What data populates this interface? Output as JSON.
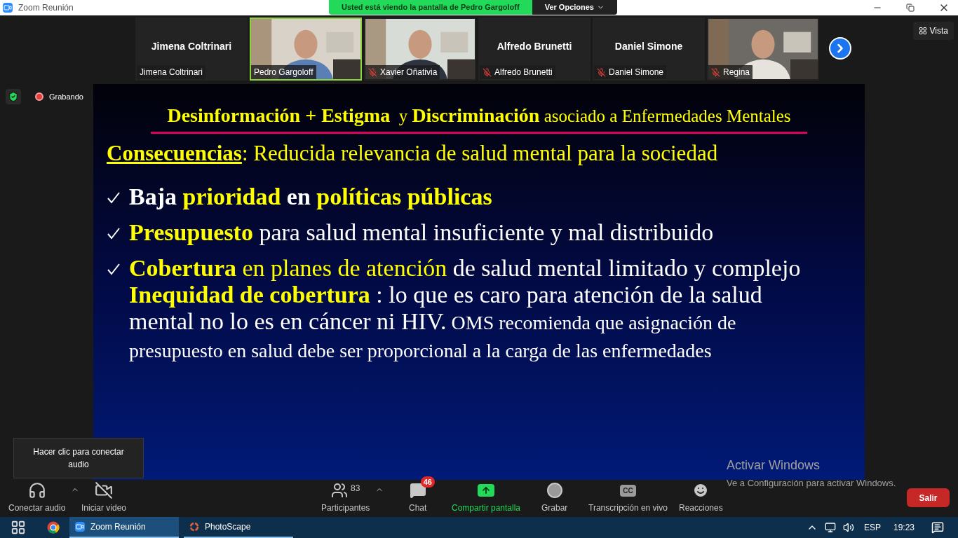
{
  "window": {
    "title": "Zoom Reunión"
  },
  "share_banner": {
    "text": "Usted está viendo la pantalla de Pedro Gargoloff",
    "options": "Ver Opciones"
  },
  "view_button": "Vista",
  "video_strip": [
    {
      "kind": "name",
      "name": "Jimena Coltrinari",
      "label": "Jimena Coltrinari",
      "muted": false,
      "speaking": false
    },
    {
      "kind": "video",
      "label": "Pedro Gargoloff",
      "muted": false,
      "speaking": true
    },
    {
      "kind": "video",
      "label": "Xavier Oñativia",
      "muted": true,
      "speaking": false
    },
    {
      "kind": "name",
      "name": "Alfredo Brunetti",
      "label": "Alfredo Brunetti",
      "muted": true,
      "speaking": false
    },
    {
      "kind": "name",
      "name": "Daniel Simone",
      "label": "Daniel Simone",
      "muted": true,
      "speaking": false
    },
    {
      "kind": "video",
      "label": "Regina",
      "muted": true,
      "speaking": false
    }
  ],
  "recording": {
    "text": "Grabando"
  },
  "slide": {
    "title": "**Desinformación + Estigma**  y **Discriminación** asociado a Enfermedades Mentales",
    "subtitle_lead": "Consecuencias",
    "subtitle": ": Reducida relevancia de salud mental para la sociedad",
    "bullets": [
      {
        "check": true,
        "segments": [
          {
            "text": "Baja ",
            "highlight": false,
            "bold": true
          },
          {
            "text": "prioridad ",
            "highlight": true,
            "bold": true
          },
          {
            "text": "en ",
            "highlight": false,
            "bold": true
          },
          {
            "text": "políticas públicas",
            "highlight": true,
            "bold": true
          }
        ]
      },
      {
        "check": true,
        "segments": [
          {
            "text": "Presupuesto ",
            "highlight": true,
            "bold": true
          },
          {
            "text": "para salud mental insuficiente y mal distribuido",
            "highlight": false,
            "bold": false
          }
        ]
      },
      {
        "check": true,
        "segments": [
          {
            "text": "Cobertura ",
            "highlight": true,
            "bold": true
          },
          {
            "text": "en planes de atención ",
            "highlight": true,
            "bold": false
          },
          {
            "text": "de salud mental limitado y complejo",
            "highlight": false,
            "bold": false
          }
        ]
      }
    ],
    "paragraph": {
      "lead": "Inequidad de cobertura",
      "text": " : lo que es caro para atención de la salud mental no lo es en cáncer ni HIV.",
      "small": " OMS recomienda que asignación de presupuesto en salud debe ser proporcional a la carga de las enfermedades"
    }
  },
  "tooltip": "Hacer clic para conectar audio",
  "toolbar": [
    {
      "kind": "audio",
      "label": "Conectar audio",
      "caret": true
    },
    {
      "kind": "video",
      "label": "Iniciar video",
      "caret": false
    },
    {
      "kind": "participants",
      "label": "Participantes",
      "count": "83",
      "caret": true
    },
    {
      "kind": "chat",
      "label": "Chat",
      "badge": "46",
      "caret": false
    },
    {
      "kind": "share",
      "label": "Compartir pantalla",
      "caret": false
    },
    {
      "kind": "record",
      "label": "Grabar",
      "caret": false
    },
    {
      "kind": "cc",
      "label": "Transcripción en vivo",
      "icon_text": "CC",
      "caret": false
    },
    {
      "kind": "reactions",
      "label": "Reacciones",
      "caret": false
    }
  ],
  "leave_button": "Salir",
  "activation": {
    "title": "Activar Windows",
    "text": "Ve a Configuración para activar Windows."
  },
  "taskbar": {
    "apps": [
      {
        "kind": "zoom",
        "label": "Zoom Reunión",
        "selected": true
      },
      {
        "kind": "photoscape",
        "label": "PhotoScape",
        "selected": false
      }
    ],
    "language": "ESP",
    "time": "19:23"
  }
}
